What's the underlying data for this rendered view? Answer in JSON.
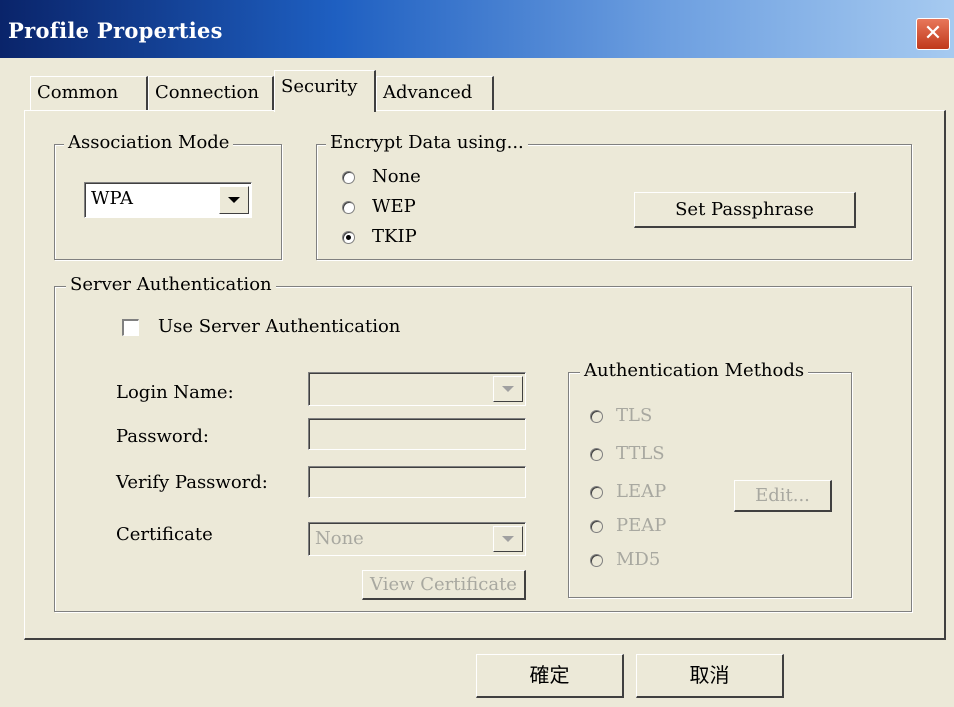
{
  "window": {
    "title": "Profile Properties",
    "close_glyph": "✕"
  },
  "tabs": [
    {
      "label": "Common"
    },
    {
      "label": "Connection"
    },
    {
      "label": "Security"
    },
    {
      "label": "Advanced"
    }
  ],
  "active_tab": "Security",
  "association": {
    "legend": "Association Mode",
    "value": "WPA"
  },
  "encrypt": {
    "legend": "Encrypt Data using...",
    "options": [
      {
        "label": "None"
      },
      {
        "label": "WEP"
      },
      {
        "label": "TKIP"
      }
    ],
    "selected": "TKIP",
    "set_passphrase_label": "Set Passphrase"
  },
  "server_auth": {
    "legend": "Server Authentication",
    "use_label": "Use Server Authentication",
    "use_checked": false,
    "login_label": "Login Name:",
    "login_value": "",
    "password_label": "Password:",
    "password_value": "",
    "verify_label": "Verify Password:",
    "verify_value": "",
    "certificate_label": "Certificate",
    "certificate_value": "None",
    "view_cert_label": "View Certificate"
  },
  "auth_methods": {
    "legend": "Authentication Methods",
    "options": [
      {
        "label": "TLS"
      },
      {
        "label": "TTLS"
      },
      {
        "label": "LEAP"
      },
      {
        "label": "PEAP"
      },
      {
        "label": "MD5"
      }
    ],
    "edit_label": "Edit..."
  },
  "footer": {
    "ok_label": "確定",
    "cancel_label": "取消"
  },
  "colors": {
    "window_bg": "#ece9d8",
    "title_start": "#0a246a",
    "title_end": "#a6caf0",
    "close_red": "#c0391b",
    "disabled_text": "#a8a8a0"
  }
}
